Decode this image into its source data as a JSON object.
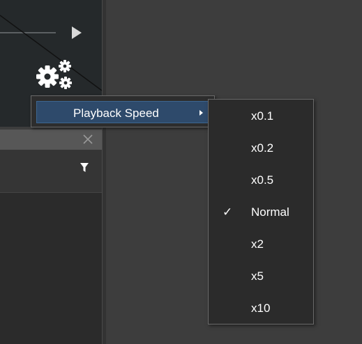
{
  "context_menu": {
    "item_label": "Playback Speed"
  },
  "speed_submenu": {
    "items": [
      {
        "label": "x0.1",
        "checked": false
      },
      {
        "label": "x0.2",
        "checked": false
      },
      {
        "label": "x0.5",
        "checked": false
      },
      {
        "label": "Normal",
        "checked": true
      },
      {
        "label": "x2",
        "checked": false
      },
      {
        "label": "x5",
        "checked": false
      },
      {
        "label": "x10",
        "checked": false
      }
    ],
    "check_glyph": "✓"
  },
  "icons": {
    "settings": "gears-icon",
    "play": "play-arrow-icon",
    "close": "close-icon",
    "filter": "filter-icon",
    "submenu_arrow": "submenu-arrow-icon",
    "check": "check-icon"
  },
  "colors": {
    "menu_highlight": "#2e4a6b",
    "menu_background": "#2d2d2d",
    "app_background": "#3d3d3d",
    "text": "#ffffff"
  }
}
